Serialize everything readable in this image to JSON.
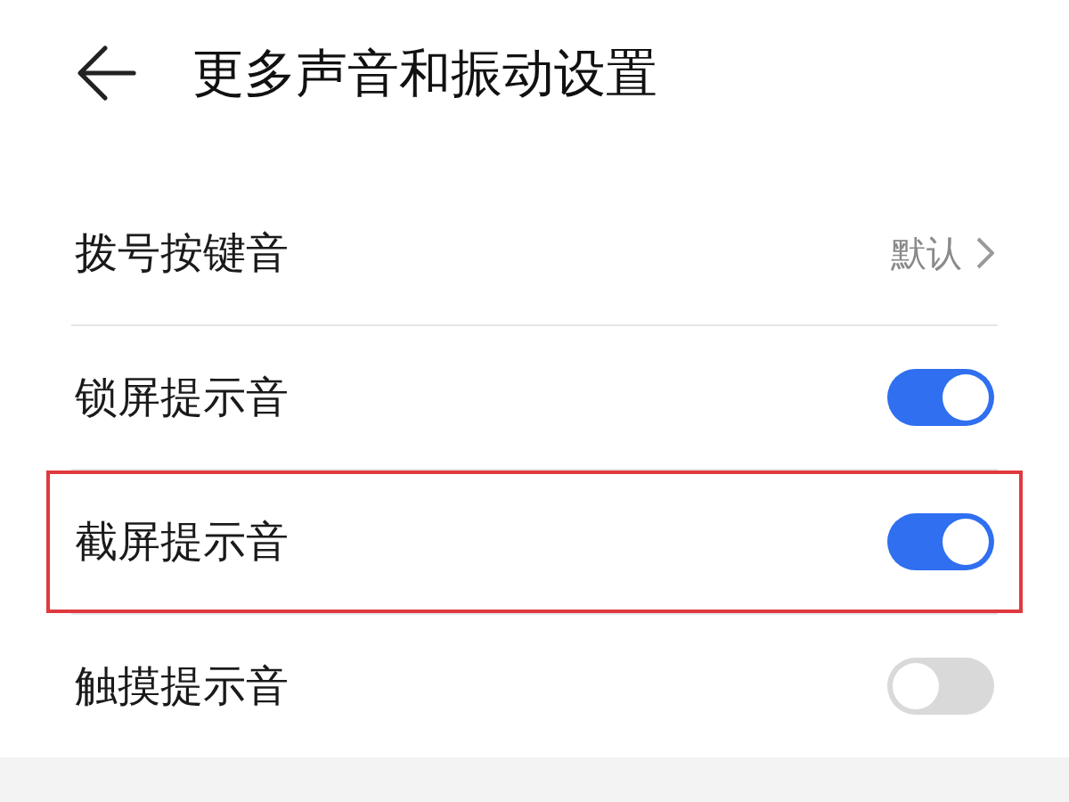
{
  "header": {
    "title": "更多声音和振动设置"
  },
  "rows": [
    {
      "kind": "link",
      "label": "拨号按键音",
      "value": "默认",
      "highlighted": false
    },
    {
      "kind": "toggle",
      "label": "锁屏提示音",
      "on": true,
      "highlighted": false
    },
    {
      "kind": "toggle",
      "label": "截屏提示音",
      "on": true,
      "highlighted": true
    },
    {
      "kind": "toggle",
      "label": "触摸提示音",
      "on": false,
      "highlighted": false
    }
  ]
}
